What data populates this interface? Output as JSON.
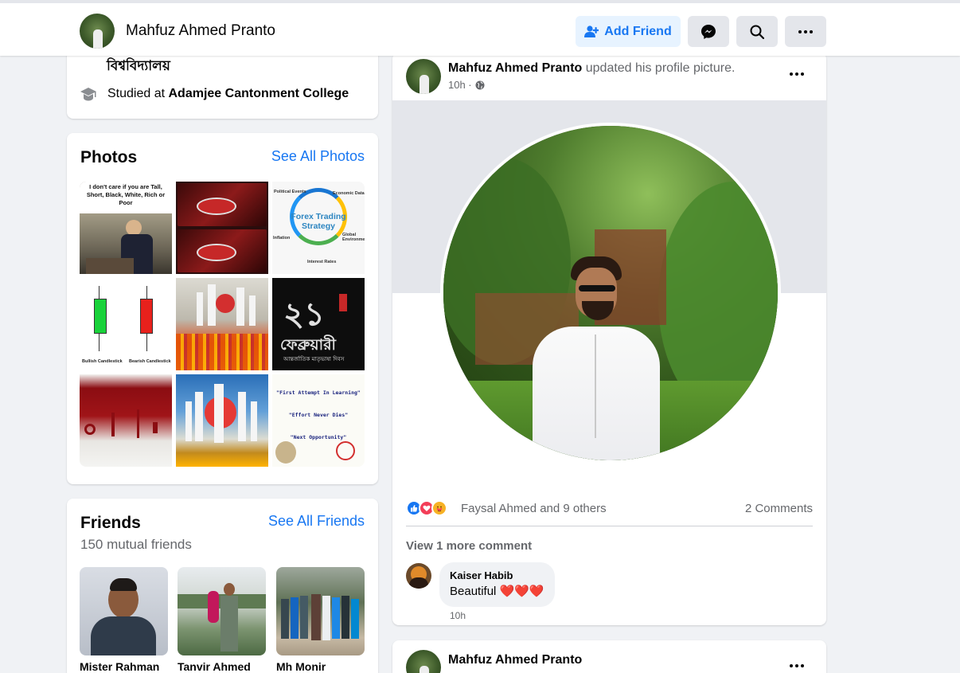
{
  "header": {
    "name": "Mahfuz Ahmed Pranto",
    "add_friend_label": "Add Friend",
    "messenger_icon": "messenger-icon",
    "search_icon": "search-icon",
    "more_icon": "more-icon"
  },
  "intro": {
    "university_text": "বিশ্ববিদ্যালয়",
    "education_prefix": "Studied at ",
    "education_school": "Adamjee Cantonment College"
  },
  "photos": {
    "title": "Photos",
    "see_all_label": "See All Photos",
    "items": [
      {
        "caption": "I don't care if you are Tall, Short, Black, White, Rich or Poor"
      },
      {
        "caption": ""
      },
      {
        "caption": "Forex Trading Strategy",
        "labels": [
          "Political Events",
          "Economic Data",
          "Global Environment",
          "Interest Rates",
          "Inflation"
        ]
      },
      {
        "caption": "",
        "labels": [
          "Bullish Candlestick",
          "Bearish Candlestick"
        ]
      },
      {
        "caption": ""
      },
      {
        "caption": "ফেব্রুয়ারী",
        "sub": "আন্তর্জাতিক মাতৃভাষা দিবস"
      },
      {
        "caption": ""
      },
      {
        "caption": ""
      },
      {
        "caption": "",
        "lines": [
          "\"First Attempt In Learning\"",
          "\"Effort Never Dies\"",
          "\"Next Opportunity\""
        ]
      }
    ]
  },
  "friends": {
    "title": "Friends",
    "see_all_label": "See All Friends",
    "mutual": "150 mutual friends",
    "items": [
      {
        "name": "Mister Rahman"
      },
      {
        "name": "Tanvir Ahmed"
      },
      {
        "name": "Mh Monir"
      }
    ]
  },
  "post": {
    "author": "Mahfuz Ahmed Pranto",
    "action": " updated his profile picture.",
    "time": "10h ·",
    "reactions_text": "Faysal Ahmed and 9 others",
    "comments_count": "2 Comments",
    "view_more": "View 1 more comment",
    "comment": {
      "author": "Kaiser Habib",
      "text": "Beautiful ❤️❤️❤️",
      "time": "10h"
    }
  },
  "post2": {
    "author": "Mahfuz Ahmed Pranto"
  },
  "colors": {
    "accent": "#1877f2",
    "accent_bg": "#e7f3ff",
    "page_bg": "#f0f2f5",
    "secondary_text": "#65676b"
  }
}
